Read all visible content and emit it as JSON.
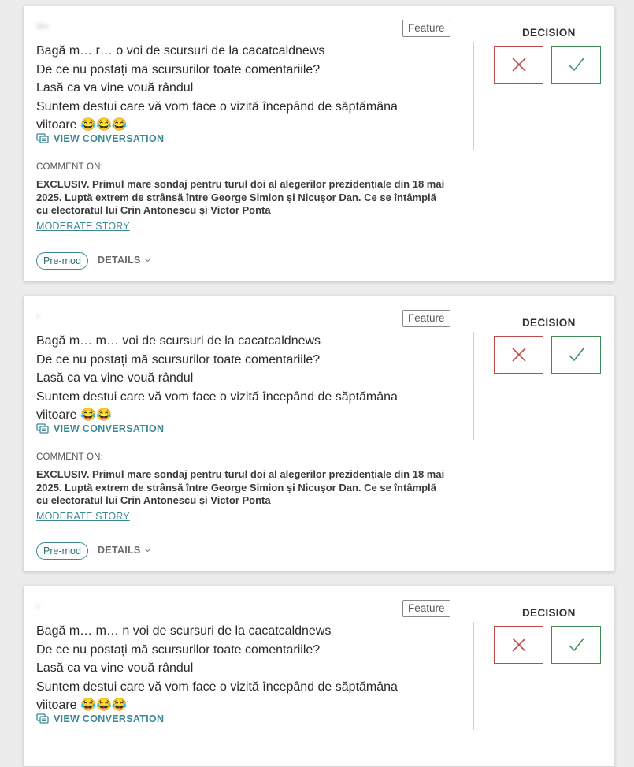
{
  "cards": [
    {
      "author": "Ilm",
      "tag": "Feature",
      "lines": [
        "Bagă m… r… o voi de scursuri de la cacatcaldnews",
        "De ce nu postați ma scursurilor toate comentariile?",
        "Lasă ca va vine vouă rândul",
        "Suntem destui care vă vom face o vizită începând de săptămâna viitoare 😂😂😂"
      ],
      "view_conversation": "VIEW CONVERSATION",
      "comment_on_label": "COMMENT ON:",
      "story_title": "EXCLUSIV. Primul mare sondaj pentru turul doi al alegerilor prezidențiale din 18 mai 2025. Luptă extrem de strânsă între George Simion și Nicușor Dan. Ce se întâmplă cu electoratul lui Crin Antonescu și Victor Ponta",
      "moderate_story": "MODERATE STORY",
      "badge": "Pre-mod",
      "details": "DETAILS",
      "decision_label": "DECISION"
    },
    {
      "author": "r",
      "tag": "Feature",
      "lines": [
        "Bagă m… m… voi de scursuri de la cacatcaldnews",
        "De ce nu postați mă scursurilor toate comentariile?",
        "Lasă ca va vine vouă rândul",
        "Suntem destui care vă vom face o vizită începând de săptămâna viitoare 😂😂"
      ],
      "view_conversation": "VIEW CONVERSATION",
      "comment_on_label": "COMMENT ON:",
      "story_title": "EXCLUSIV. Primul mare sondaj pentru turul doi al alegerilor prezidențiale din 18 mai 2025. Luptă extrem de strânsă între George Simion și Nicușor Dan. Ce se întâmplă cu electoratul lui Crin Antonescu și Victor Ponta",
      "moderate_story": "MODERATE STORY",
      "badge": "Pre-mod",
      "details": "DETAILS",
      "decision_label": "DECISION"
    },
    {
      "author": "i",
      "tag": "Feature",
      "lines": [
        "Bagă m… m… n voi de scursuri de la cacatcaldnews",
        "De ce nu postați mă scursurilor toate comentariile?",
        "Lasă ca va vine vouă rândul",
        "Suntem destui care vă vom face o vizită începând de săptămâna viitoare 😂😂😂"
      ],
      "view_conversation": "VIEW CONVERSATION",
      "decision_label": "DECISION"
    }
  ],
  "colors": {
    "accent": "#3a8894",
    "reject": "#b84a4a",
    "approve": "#3f8a53"
  },
  "icons": {
    "reject": "close-icon",
    "approve": "check-icon",
    "conversation": "conversation-icon",
    "details": "chevron-down-icon"
  }
}
